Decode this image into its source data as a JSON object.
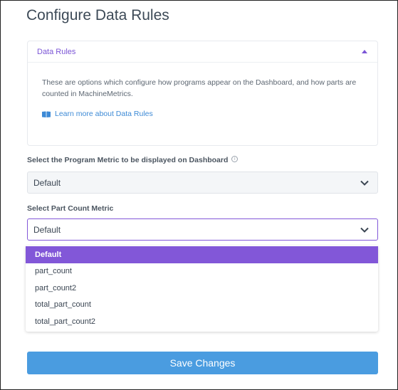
{
  "page": {
    "title": "Configure Data Rules"
  },
  "panel": {
    "title": "Data Rules",
    "description": "These are options which configure how programs appear on the Dashboard, and how parts are counted in MachineMetrics.",
    "learn_more": "Learn more about Data Rules"
  },
  "program_metric": {
    "label": "Select the Program Metric to be displayed on Dashboard",
    "value": "Default"
  },
  "part_count": {
    "label": "Select Part Count Metric",
    "value": "Default",
    "options": [
      "Default",
      "part_count",
      "part_count2",
      "total_part_count",
      "total_part_count2"
    ],
    "selected": "Default"
  },
  "save_button": {
    "label": "Save Changes"
  },
  "colors": {
    "accent": "#8257d8",
    "primary_button": "#4a9ce0",
    "link": "#3d8ad6"
  }
}
